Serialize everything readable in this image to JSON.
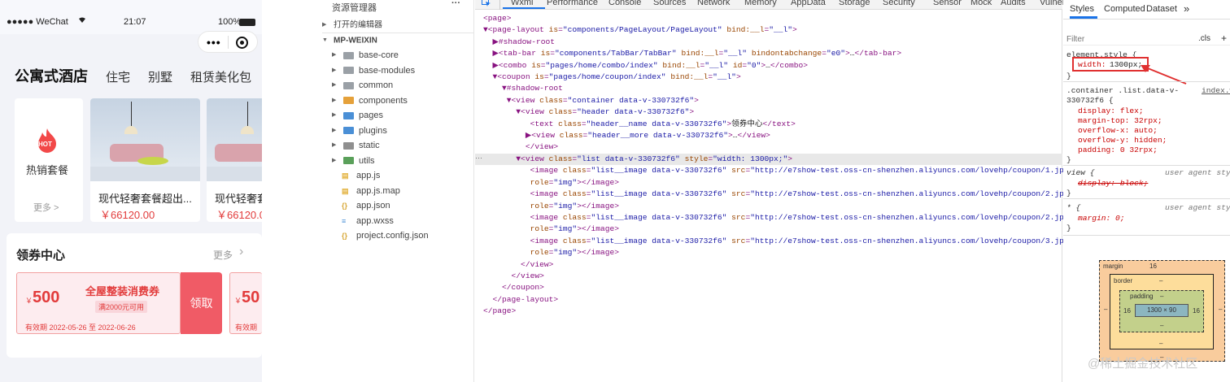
{
  "phone": {
    "status": {
      "carrier": "●●●●● WeChat",
      "time": "21:07",
      "battery": "100%"
    },
    "tabs": [
      "公寓式酒店",
      "住宅",
      "别墅",
      "租赁美化包"
    ],
    "hot": {
      "badge": "HOT",
      "label": "热销套餐",
      "more": "更多 >"
    },
    "products": [
      {
        "name": "现代轻奢套餐超出...",
        "price": "￥66120.00"
      },
      {
        "name": "现代轻奢套",
        "price": "￥66120.0"
      }
    ],
    "coupon_section": {
      "title": "领券中心",
      "more": "更多"
    },
    "coupons": [
      {
        "amount_prefix": "￥",
        "amount": "500",
        "title": "全屋整装消费券",
        "condition": "满2000元可用",
        "validity": "有效期 2022-05-26 至 2022-06-26",
        "button": "领取"
      },
      {
        "amount_prefix": "￥",
        "amount": "50",
        "validity": "有效期"
      }
    ]
  },
  "explorer": {
    "title": "资源管理器",
    "menu": "···",
    "open_editors": "打开的编辑器",
    "project": "MP-WEIXIN",
    "folders": [
      "base-core",
      "base-modules",
      "common",
      "components",
      "pages",
      "plugins",
      "static",
      "utils"
    ],
    "files": [
      "app.js",
      "app.js.map",
      "app.json",
      "app.wxss",
      "project.config.json"
    ],
    "colors": {
      "folder": "#9aa0a6",
      "components": "#e5a13a",
      "pages": "#4a8fd6",
      "plugins": "#4a8fd6",
      "static": "#8f8f8f",
      "utils": "#5aa05a",
      "js": "#e3b341",
      "json": "#d8a93a",
      "wxss": "#4a8fd6"
    }
  },
  "devtools": {
    "tabs": [
      "Wxml",
      "Performance",
      "Console",
      "Sources",
      "Network",
      "Memory",
      "AppData",
      "Storage",
      "Security",
      "Sensor",
      "Mock",
      "Audits",
      "Vulnerability"
    ],
    "active_tab": "Wxml",
    "badges": {
      "warn": "4",
      "info": "1"
    },
    "dom_lines": [
      "<page>",
      "▼<page-layout is=\"components/PageLayout/PageLayout\" bind:__l=\"__l\">",
      "  ▶#shadow-root",
      "  ▶<tab-bar is=\"components/TabBar/TabBar\" bind:__l=\"__l\" bindontabchange=\"e0\">…</tab-bar>",
      "  ▶<combo is=\"pages/home/combo/index\" bind:__l=\"__l\" id=\"0\">…</combo>",
      "  ▼<coupon is=\"pages/home/coupon/index\" bind:__l=\"__l\">",
      "    ▼#shadow-root",
      "     ▼<view class=\"container data-v-330732f6\">",
      "       ▼<view class=\"header data-v-330732f6\">",
      "          <text class=\"header__name data-v-330732f6\">领券中心</text>",
      "         ▶<view class=\"header__more data-v-330732f6\">…</view>",
      "         </view>",
      "       ▼<view class=\"list data-v-330732f6\" style=\"width: 1300px;\">",
      "          <image class=\"list__image data-v-330732f6\" src=\"http://e7show-test.oss-cn-shenzhen.aliyuncs.com/lovehp/coupon/1.jpg\"",
      "          role=\"img\"></image>",
      "          <image class=\"list__image data-v-330732f6\" src=\"http://e7show-test.oss-cn-shenzhen.aliyuncs.com/lovehp/coupon/2.jpg\"",
      "          role=\"img\"></image>",
      "          <image class=\"list__image data-v-330732f6\" src=\"http://e7show-test.oss-cn-shenzhen.aliyuncs.com/lovehp/coupon/2.jpg\"",
      "          role=\"img\"></image>",
      "          <image class=\"list__image data-v-330732f6\" src=\"http://e7show-test.oss-cn-shenzhen.aliyuncs.com/lovehp/coupon/3.jpg\"",
      "          role=\"img\"></image>",
      "        </view>",
      "      </view>",
      "    </coupon>",
      "  </page-layout>",
      "</page>"
    ],
    "selected_line": 12,
    "ellipsis": "···"
  },
  "styles": {
    "tabs": [
      "Styles",
      "Computed",
      "Dataset"
    ],
    "more_tabs": "»",
    "filter_placeholder": "Filter",
    "cls": ".cls",
    "add": "+",
    "element_style": "element.style {",
    "width_prop": "width:",
    "width_val": "1300px;",
    "close": "}",
    "rule2_selector": ".container .list.data-v-330732f6 {",
    "rule2_source": "index.w",
    "rule2_props": [
      "display: flex;",
      "margin-top: 32rpx;",
      "overflow-x: auto;",
      "overflow-y: hidden;",
      "padding: 0 32rpx;"
    ],
    "rule3_selector": "view {",
    "ua": "user agent style",
    "rule3_prop": "display: block;",
    "rule4_selector": "* {",
    "rule4_prop": "margin: 0;",
    "boxmodel": {
      "margin": "margin",
      "margin_val": "16",
      "border": "border",
      "border_val": "–",
      "padding": "padding",
      "padding_val": "–",
      "content": "1300 × 90",
      "left": "16",
      "right": "16",
      "outer_left": "–",
      "outer_right": "–",
      "bottom_margin": "–",
      "bottom_border": "–"
    },
    "highlight_color": "#e03030"
  },
  "watermark": "@稀土掘金技术社区"
}
